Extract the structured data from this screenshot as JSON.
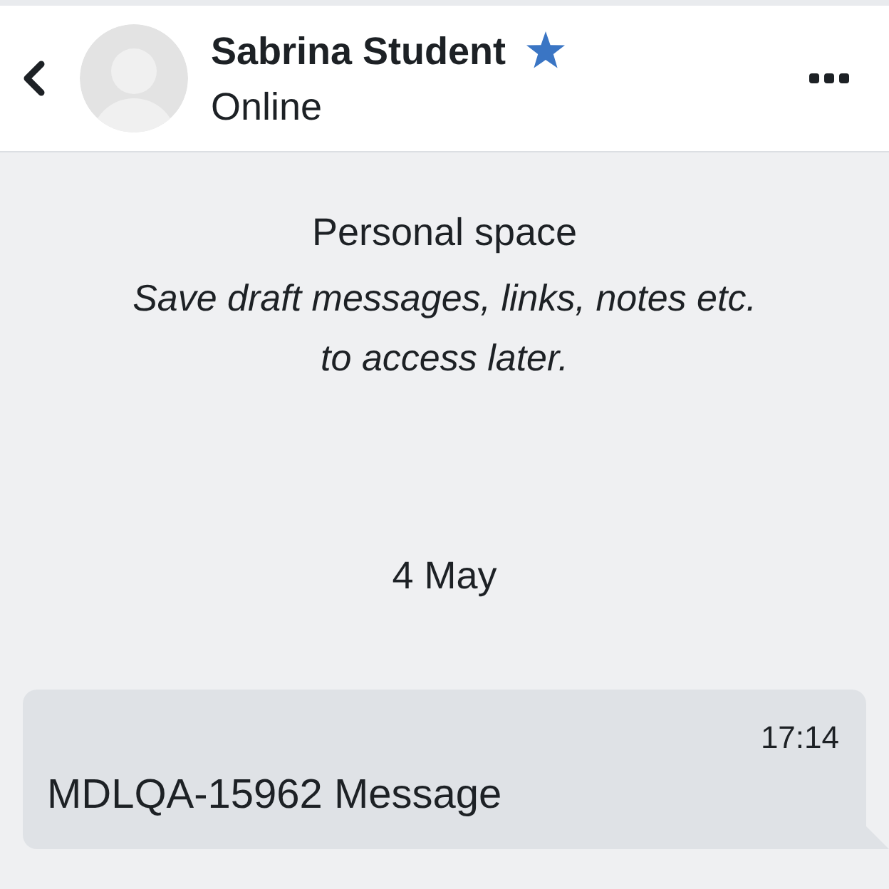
{
  "contact": {
    "name": "Sabrina Student",
    "starred": true,
    "status": "Online"
  },
  "personal_space": {
    "title": "Personal space",
    "description": "Save draft messages, links, notes etc. to access later."
  },
  "messages": [
    {
      "kind": "date",
      "text": "4 May"
    },
    {
      "kind": "message",
      "own": true,
      "time": "17:14",
      "text": "MDLQA-15962 Message"
    }
  ]
}
